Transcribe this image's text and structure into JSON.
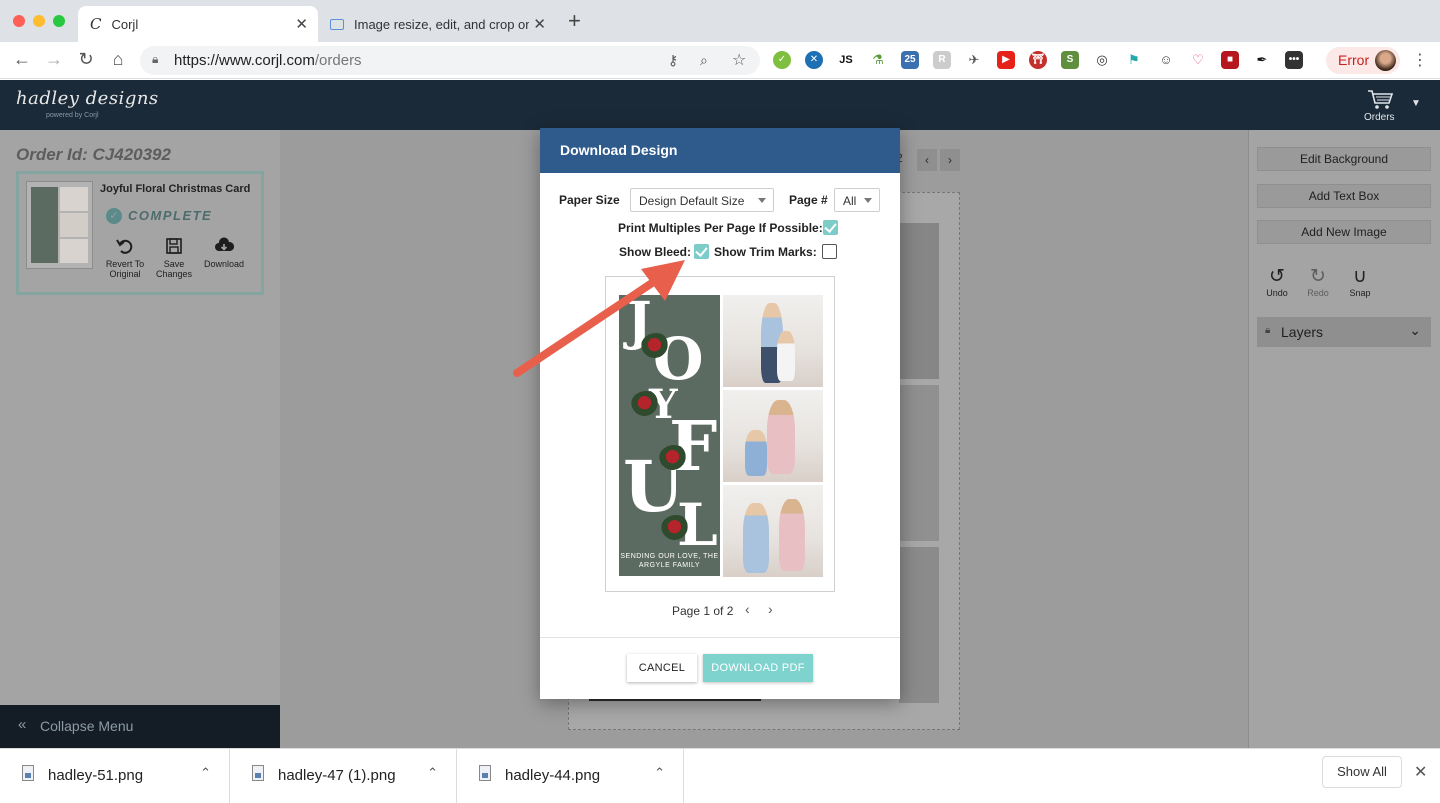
{
  "browser": {
    "tabs": [
      {
        "title": "Corjl",
        "active": true
      },
      {
        "title": "Image resize, edit, and crop on",
        "active": false
      }
    ],
    "url_host": "https://www.corjl.com",
    "url_path": "/orders",
    "error_label": "Error"
  },
  "app": {
    "logo": "hadley designs",
    "logo_sub": "powered by Corjl",
    "orders_label": "Orders"
  },
  "order": {
    "order_id": "Order Id: CJ420392",
    "card_title": "Joyful Floral Christmas Card",
    "status": "COMPLETE",
    "actions": {
      "revert": "Revert To Original",
      "save": "Save Changes",
      "download": "Download"
    }
  },
  "sidebar": {
    "collapse_label": "Collapse Menu"
  },
  "canvas": {
    "pager_partial": "2"
  },
  "right_panel": {
    "edit_background": "Edit Background",
    "add_text_box": "Add Text Box",
    "add_new_image": "Add New Image",
    "undo": "Undo",
    "redo": "Redo",
    "snap": "Snap",
    "layers": "Layers"
  },
  "modal": {
    "title": "Download Design",
    "paper_size_label": "Paper Size",
    "paper_size_value": "Design Default Size",
    "page_label": "Page #",
    "page_value": "All",
    "print_multiples_label": "Print Multiples Per Page If Possible:",
    "print_multiples_checked": true,
    "show_bleed_label": "Show Bleed:",
    "show_bleed_checked": true,
    "show_trim_label": "Show Trim Marks:",
    "show_trim_checked": false,
    "preview_letters": [
      "J",
      "O",
      "Y",
      "F",
      "U",
      "L"
    ],
    "preview_caption": "SENDING OUR LOVE, THE ARGYLE FAMILY",
    "page_info": "Page 1 of 2",
    "cancel": "CANCEL",
    "download_pdf": "DOWNLOAD PDF"
  },
  "downloads": {
    "files": [
      "hadley-51.png",
      "hadley-47 (1).png",
      "hadley-44.png"
    ],
    "show_all": "Show All"
  },
  "colors": {
    "header_bg": "#1b2a38",
    "modal_header": "#2e5b8b",
    "accent_teal": "#7fd3cf",
    "arrow": "#e8604c"
  }
}
